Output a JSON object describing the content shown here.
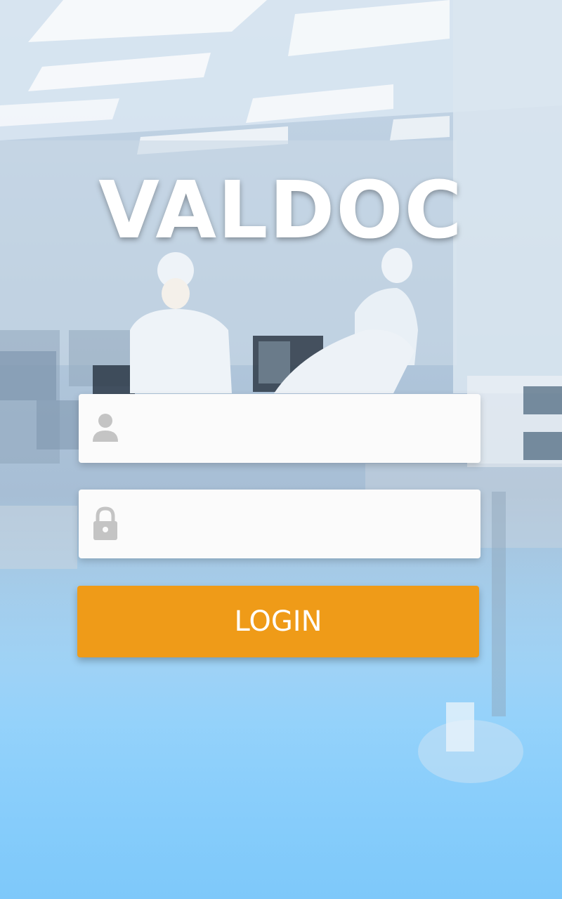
{
  "app": {
    "title": "VALDOC"
  },
  "login_form": {
    "username": {
      "value": "",
      "placeholder": "",
      "icon": "user-icon"
    },
    "password": {
      "value": "",
      "placeholder": "",
      "icon": "lock-icon"
    },
    "submit_label": "LOGIN"
  },
  "colors": {
    "button": "#ef9b18",
    "field_background": "#fbfbfb",
    "icon": "#c4c4c4"
  }
}
